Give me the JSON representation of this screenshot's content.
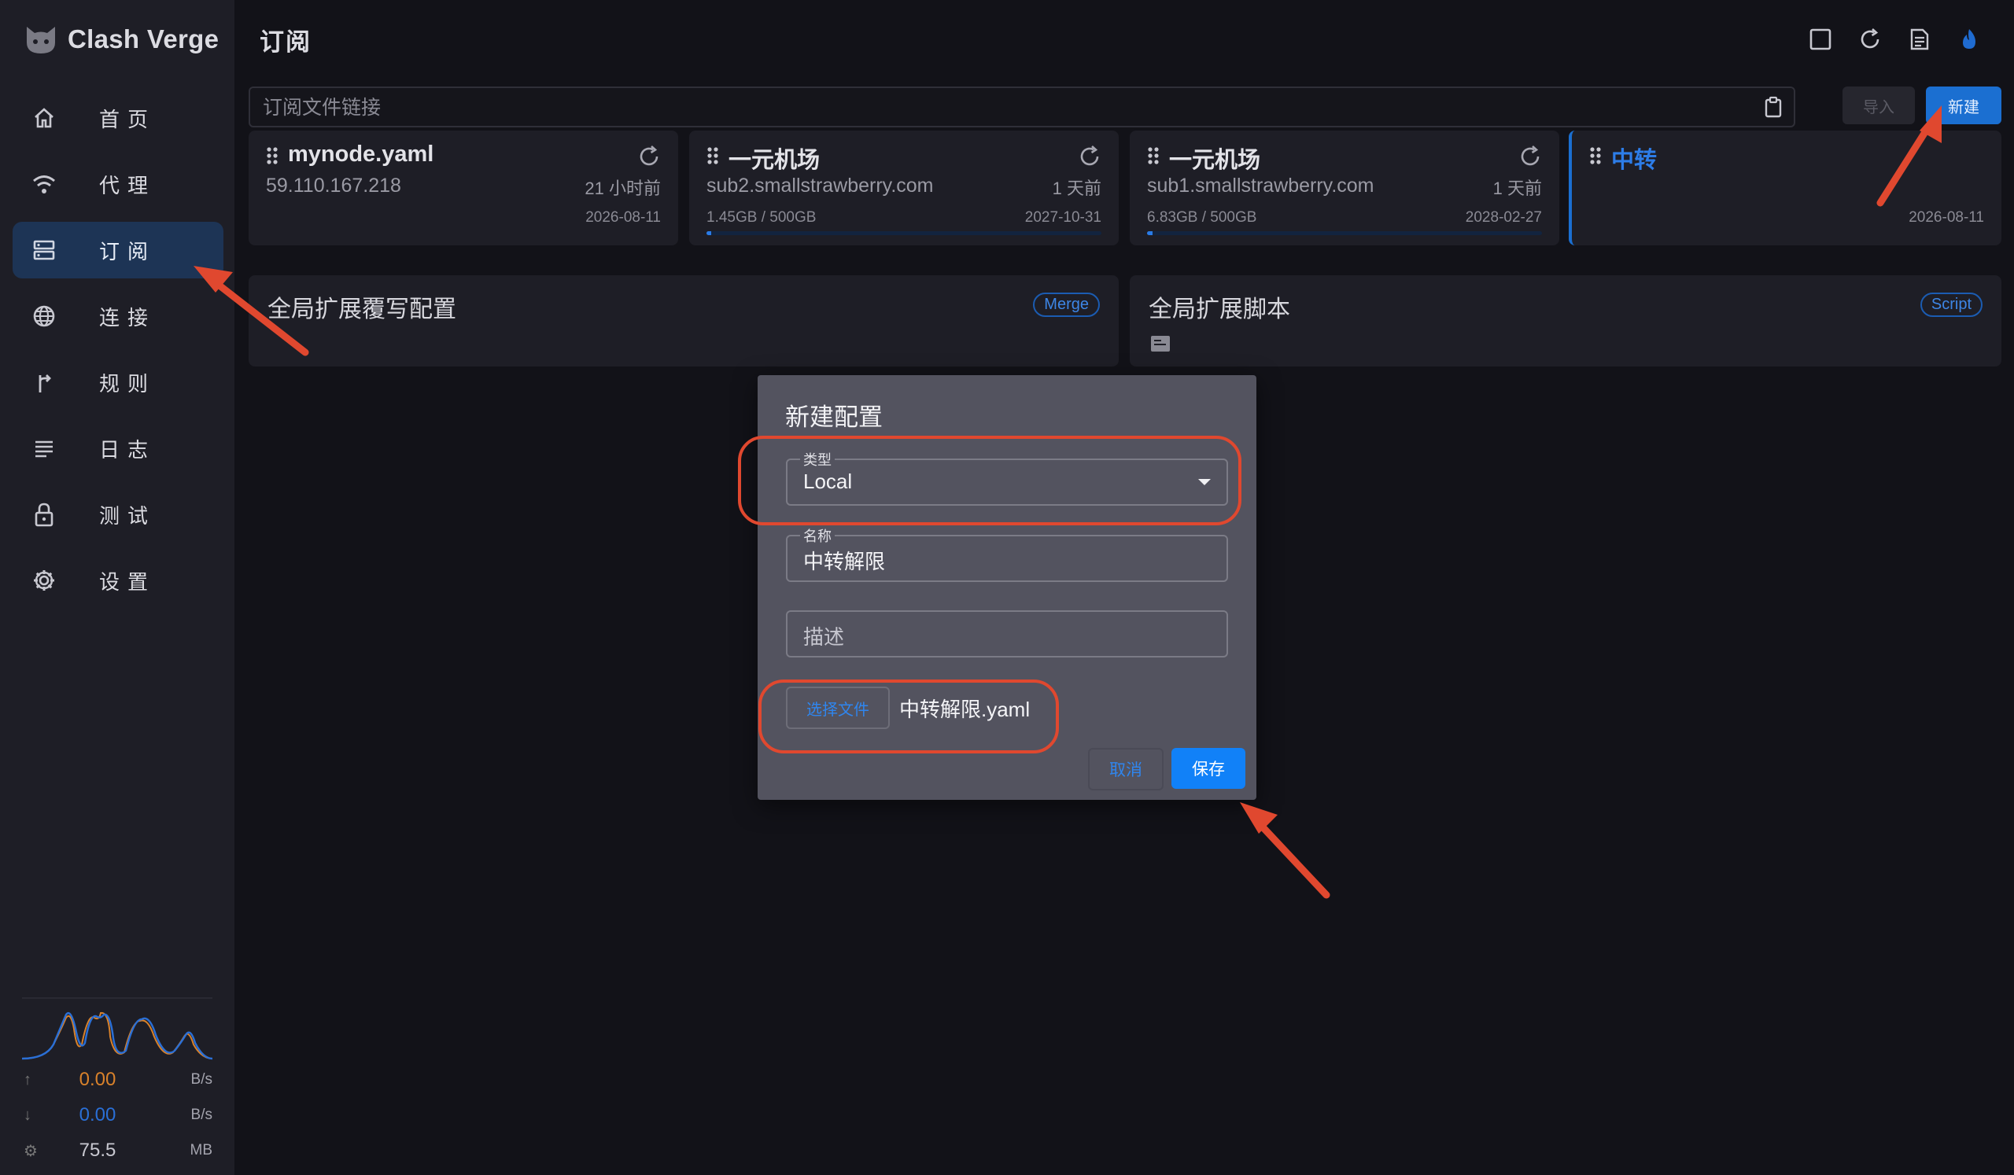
{
  "app": {
    "name": "Clash Verge"
  },
  "sidebar": {
    "items": [
      {
        "label": "首页",
        "icon": "home-icon",
        "active": false
      },
      {
        "label": "代理",
        "icon": "wifi-icon",
        "active": false
      },
      {
        "label": "订阅",
        "icon": "server-icon",
        "active": true
      },
      {
        "label": "连接",
        "icon": "globe-icon",
        "active": false
      },
      {
        "label": "规则",
        "icon": "fork-icon",
        "active": false
      },
      {
        "label": "日志",
        "icon": "list-icon",
        "active": false
      },
      {
        "label": "测试",
        "icon": "lock-icon",
        "active": false
      },
      {
        "label": "设置",
        "icon": "gear-icon",
        "active": false
      }
    ],
    "traffic": {
      "upload": {
        "value": "0.00",
        "unit": "B/s",
        "color": "#d9822b"
      },
      "download": {
        "value": "0.00",
        "unit": "B/s",
        "color": "#2a6fd6"
      },
      "memory": {
        "value": "75.5",
        "unit": "MB"
      }
    }
  },
  "header": {
    "title": "订阅",
    "buttons": [
      "fullscreen-icon",
      "refresh-icon",
      "log-icon",
      "fire-icon"
    ]
  },
  "url_bar": {
    "placeholder": "订阅文件链接",
    "import_label": "导入",
    "new_label": "新建"
  },
  "profiles": [
    {
      "name": "mynode.yaml",
      "subtitle": "59.110.167.218",
      "ago": "21 小时前",
      "usage": "",
      "date": "2026-08-11",
      "progress": 0
    },
    {
      "name": "一元机场",
      "subtitle": "sub2.smallstrawberry.com",
      "ago": "1 天前",
      "usage": "1.45GB / 500GB",
      "date": "2027-10-31",
      "progress": 0.003
    },
    {
      "name": "一元机场",
      "subtitle": "sub1.smallstrawberry.com",
      "ago": "1 天前",
      "usage": "6.83GB / 500GB",
      "date": "2028-02-27",
      "progress": 0.014
    },
    {
      "name": "中转",
      "subtitle": "",
      "ago": "",
      "usage": "",
      "date": "2026-08-11",
      "progress": 0
    }
  ],
  "enhance": {
    "merge": {
      "title": "全局扩展覆写配置",
      "chip": "Merge"
    },
    "script": {
      "title": "全局扩展脚本",
      "chip": "Script"
    }
  },
  "dialog": {
    "title": "新建配置",
    "type_label": "类型",
    "type_value": "Local",
    "name_label": "名称",
    "name_value": "中转解限",
    "desc_placeholder": "描述",
    "choose_file_label": "选择文件",
    "file_name": "中转解限.yaml",
    "cancel_label": "取消",
    "save_label": "保存"
  },
  "colors": {
    "accent": "#1b6fd1",
    "annotation": "#e0482f"
  }
}
